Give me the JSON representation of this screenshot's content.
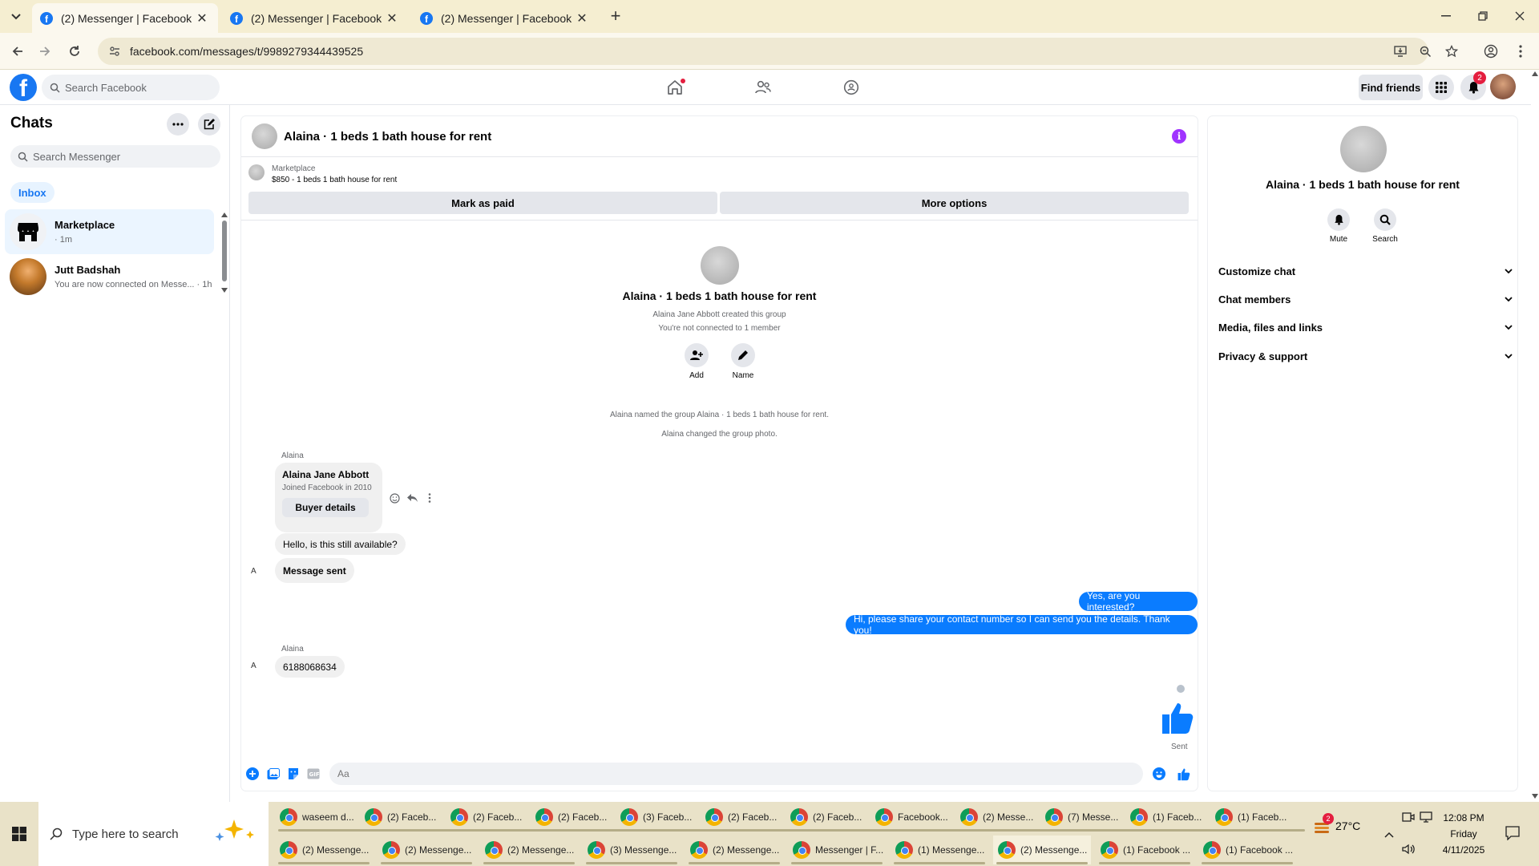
{
  "browser": {
    "tabs": [
      {
        "title": "(2) Messenger | Facebook",
        "active": true
      },
      {
        "title": "(2) Messenger | Facebook",
        "active": false
      },
      {
        "title": "(2) Messenger | Facebook",
        "active": false
      }
    ],
    "url": "facebook.com/messages/t/9989279344439525"
  },
  "fb_header": {
    "search_placeholder": "Search Facebook",
    "find_friends_label": "Find friends",
    "notification_count": "2"
  },
  "sidebar": {
    "title": "Chats",
    "search_placeholder": "Search Messenger",
    "inbox_label": "Inbox",
    "chats": [
      {
        "name": "Marketplace",
        "sub": "· 1m",
        "active": true
      },
      {
        "name": "Jutt Badshah",
        "sub": "You are now connected on Messe... · 1h",
        "active": false
      }
    ]
  },
  "conversation": {
    "title": "Alaina · 1 beds 1 bath house for rent",
    "marketplace_label": "Marketplace",
    "marketplace_item": "$850 - 1 beds 1 bath house for rent",
    "mark_paid_label": "Mark as paid",
    "more_options_label": "More options",
    "group_name": "Alaina · 1 beds 1 bath house for rent",
    "created_by": "Alaina Jane Abbott created this group",
    "not_connected": "You're not connected to 1 member",
    "add_label": "Add",
    "name_label": "Name",
    "event_named": "Alaina named the group Alaina · 1 beds 1 bath house for rent.",
    "event_photo": "Alaina changed the group photo.",
    "sender_1": "Alaina",
    "buyer_name": "Alaina Jane Abbott",
    "buyer_joined": "Joined Facebook in 2010",
    "buyer_details_label": "Buyer details",
    "msg_in_1": "Hello, is this still available?",
    "msg_in_2": "Message sent",
    "avatar_alt": "A",
    "msg_out_1": "Yes, are you interested?",
    "msg_out_2": "Hi, please share your contact number so I can send you the details. Thank you!",
    "sender_2": "Alaina",
    "msg_in_3": "6188068634",
    "sent_label": "Sent",
    "composer_placeholder": "Aa"
  },
  "right_panel": {
    "name": "Alaina · 1 beds 1 bath house for rent",
    "mute_label": "Mute",
    "search_label": "Search",
    "sections": [
      "Customize chat",
      "Chat members",
      "Media, files and links",
      "Privacy & support"
    ]
  },
  "taskbar": {
    "search_placeholder": "Type here to search",
    "row1": [
      "waseem d...",
      "(2) Faceb...",
      "(2) Faceb...",
      "(2) Faceb...",
      "(3) Faceb...",
      "(2) Faceb...",
      "(2) Faceb...",
      "Facebook...",
      "(2) Messe...",
      "(7) Messe...",
      "(1) Faceb...",
      "(1) Faceb..."
    ],
    "row2": [
      "(2) Messenge...",
      "(2) Messenge...",
      "(2) Messenge...",
      "(3) Messenge...",
      "(2) Messenge...",
      "Messenger | F...",
      "(1) Messenge...",
      "(2) Messenge...",
      "(1) Facebook ...",
      "(1) Facebook ..."
    ],
    "weather": "27°C",
    "weather_badge": "2",
    "time": "12:08 PM",
    "day": "Friday",
    "date": "4/11/2025"
  },
  "colors": {
    "fb_blue": "#1877f2",
    "bubble_out": "#0a7cff",
    "info_purple": "#a033ff",
    "tab_strip": "#f5eed1"
  }
}
